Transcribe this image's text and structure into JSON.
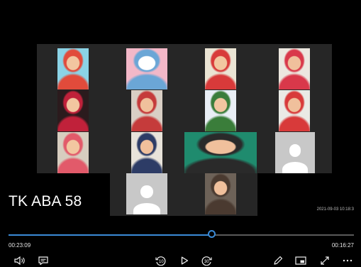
{
  "video": {
    "overlay_title": "TK ABA 58",
    "recorded_timestamp": "2021-09-03 10:18:3"
  },
  "participants": [
    {
      "kind": "photo",
      "palette": [
        "#8bd3e6",
        "#e14b3b",
        "#f2c6a0"
      ],
      "icon": "participant-video"
    },
    {
      "kind": "photo",
      "palette": [
        "#f3b8c8",
        "#6ba6d6",
        "#ffffff"
      ],
      "icon": "participant-video"
    },
    {
      "kind": "photo",
      "palette": [
        "#eae4d4",
        "#d83a3a",
        "#f2c6a0"
      ],
      "icon": "participant-video"
    },
    {
      "kind": "photo",
      "palette": [
        "#ece7df",
        "#d9384a",
        "#f0c09c"
      ],
      "icon": "participant-video"
    },
    {
      "kind": "photo",
      "palette": [
        "#2b1b1d",
        "#c0213a",
        "#f2c6a0"
      ],
      "icon": "participant-video"
    },
    {
      "kind": "photo",
      "palette": [
        "#d9cfc5",
        "#c53b3b",
        "#f0c09c"
      ],
      "icon": "participant-video"
    },
    {
      "kind": "photo",
      "palette": [
        "#e9eef5",
        "#3a7d3a",
        "#f2c6a0"
      ],
      "icon": "participant-video"
    },
    {
      "kind": "photo",
      "palette": [
        "#eaeae5",
        "#d83a3a",
        "#f0c09c"
      ],
      "icon": "participant-video"
    },
    {
      "kind": "photo",
      "palette": [
        "#d7cdbf",
        "#e25a6a",
        "#f2c6a0"
      ],
      "icon": "participant-video"
    },
    {
      "kind": "photo",
      "palette": [
        "#e8e3da",
        "#2d3c66",
        "#f0c09c"
      ],
      "icon": "participant-video"
    },
    {
      "kind": "photo",
      "palette": [
        "#1f8b6e",
        "#2a2a2a",
        "#f0c09c"
      ],
      "icon": "participant-video"
    },
    {
      "kind": "avatar",
      "icon": "person-avatar-icon"
    },
    {
      "kind": "avatar",
      "icon": "person-avatar-icon"
    },
    {
      "kind": "photo",
      "palette": [
        "#6d6258",
        "#4a3a30",
        "#f0c09c"
      ],
      "icon": "participant-video"
    }
  ],
  "player": {
    "elapsed": "00:23:09",
    "remaining": "00:16:27",
    "progress_fraction": 0.59,
    "accent_color": "#3a8ad6",
    "skip_back_seconds": "10",
    "skip_forward_seconds": "30",
    "icons": [
      "volume-icon",
      "subtitles-icon",
      "skip-back-icon",
      "play-icon",
      "skip-forward-icon",
      "pen-icon",
      "miniview-icon",
      "fullscreen-icon",
      "more-icon"
    ]
  }
}
